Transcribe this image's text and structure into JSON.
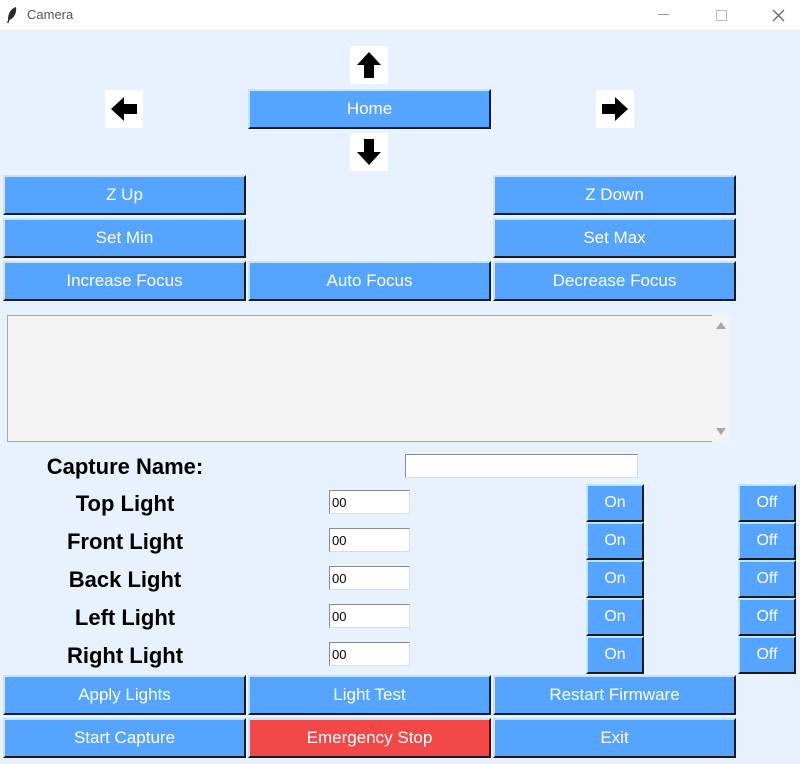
{
  "window": {
    "title": "Camera"
  },
  "nav": {
    "home": "Home"
  },
  "buttons": {
    "z_up": "Z Up",
    "z_down": "Z Down",
    "set_min": "Set Min",
    "set_max": "Set Max",
    "increase_focus": "Increase Focus",
    "auto_focus": "Auto Focus",
    "decrease_focus": "Decrease Focus",
    "apply_lights": "Apply Lights",
    "light_test": "Light Test",
    "restart_firmware": "Restart Firmware",
    "start_capture": "Start Capture",
    "emergency_stop": "Emergency Stop",
    "exit": "Exit"
  },
  "capture": {
    "label": "Capture Name:",
    "value": ""
  },
  "lights": [
    {
      "label": "Top Light",
      "value": "00",
      "on": "On",
      "off": "Off"
    },
    {
      "label": "Front Light",
      "value": "00",
      "on": "On",
      "off": "Off"
    },
    {
      "label": "Back Light",
      "value": "00",
      "on": "On",
      "off": "Off"
    },
    {
      "label": "Left Light",
      "value": "00",
      "on": "On",
      "off": "Off"
    },
    {
      "label": "Right Light",
      "value": "00",
      "on": "On",
      "off": "Off"
    }
  ],
  "colors": {
    "button": "#55a4ff",
    "danger": "#f44747",
    "background": "#e8f2fe"
  }
}
